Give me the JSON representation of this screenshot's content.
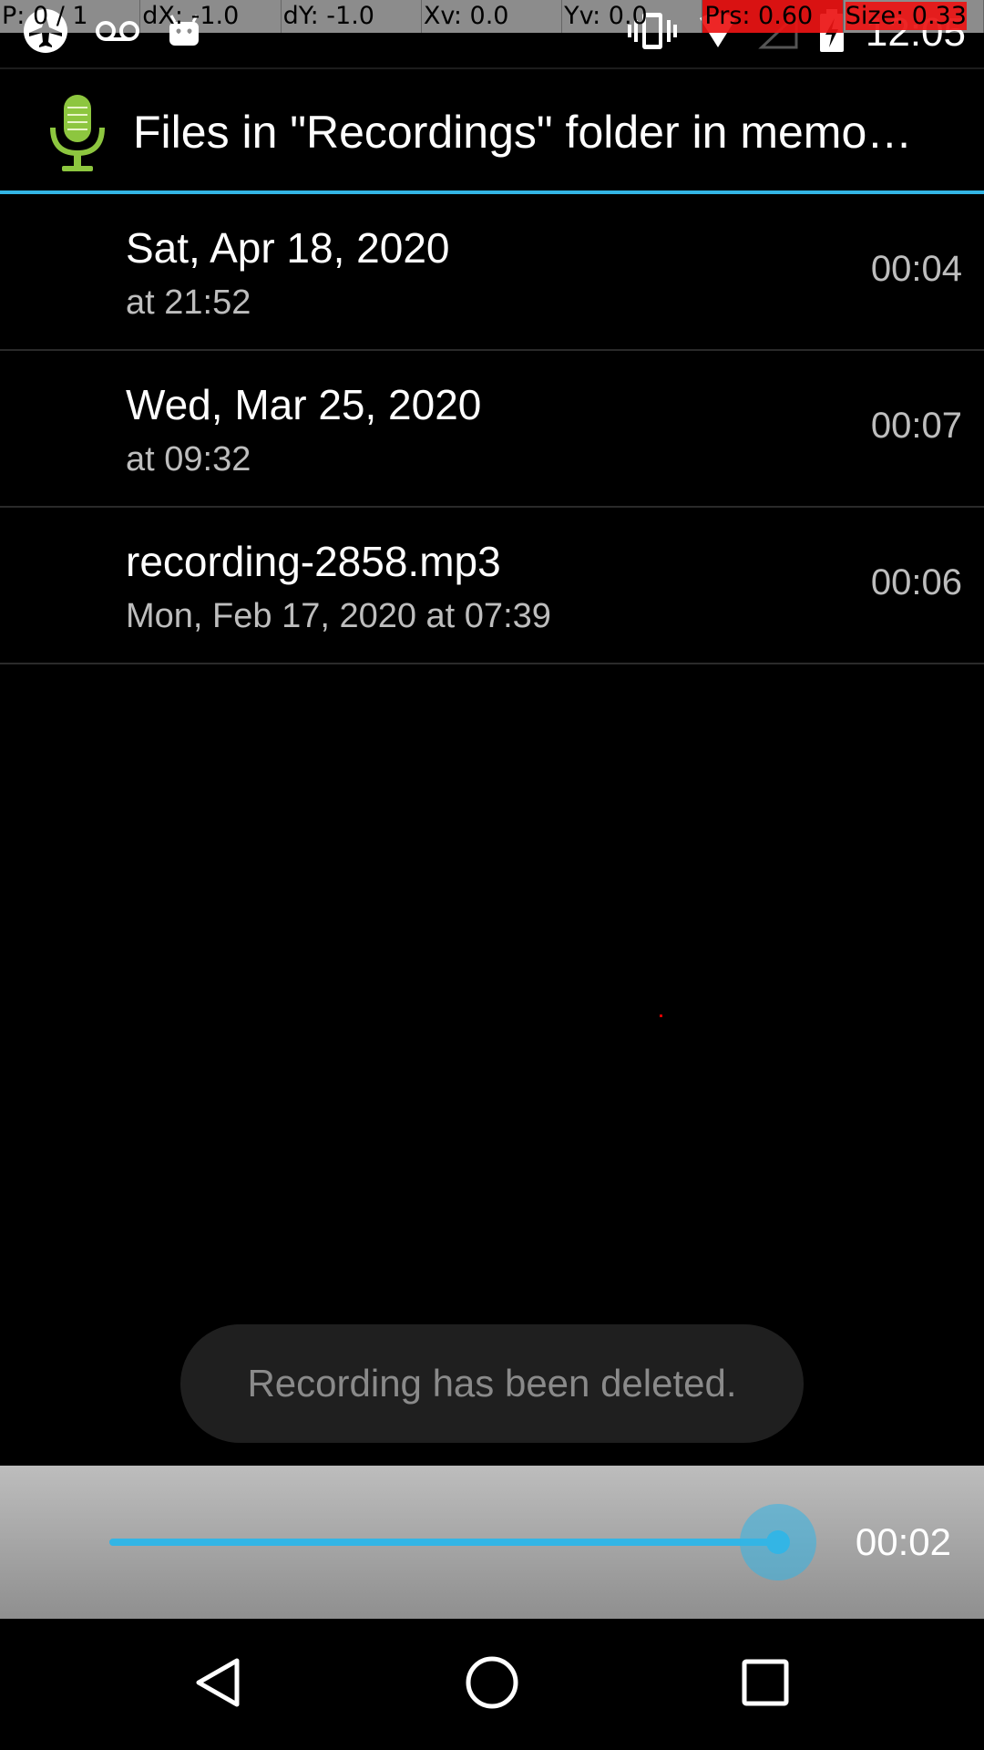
{
  "debug_overlay": {
    "cells": [
      "P: 0 / 1",
      "dX: -1.0",
      "dY: -1.0",
      "Xv: 0.0",
      "Yv: 0.0",
      "Prs: 0.60",
      "Size: 0.33"
    ],
    "alert_color": "#eb1414"
  },
  "status_bar": {
    "time": "12:05",
    "left_icons": [
      "airplane-mode-icon",
      "voicemail-icon",
      "android-icon"
    ],
    "right_icons": [
      "vibrate-icon",
      "wifi-icon",
      "signal-icon",
      "battery-charging-icon"
    ]
  },
  "action_bar": {
    "title": "Files in \"Recordings\" folder in memo…",
    "app_icon": "microphone-icon",
    "accent_color": "#33b5e5"
  },
  "recordings": [
    {
      "title": "Sat, Apr 18, 2020",
      "subtitle": "at 21:52",
      "duration": "00:04"
    },
    {
      "title": "Wed, Mar 25, 2020",
      "subtitle": "at 09:32",
      "duration": "00:07"
    },
    {
      "title": "recording-2858.mp3",
      "subtitle": "Mon, Feb 17, 2020 at 07:39",
      "duration": "00:06"
    }
  ],
  "toast": {
    "message": "Recording has been deleted."
  },
  "player": {
    "elapsed": "00:02",
    "progress_fraction": 1.0,
    "seek_color": "#33b5e5"
  },
  "nav_bar": {
    "buttons": [
      "back-icon",
      "home-icon",
      "recents-icon"
    ]
  }
}
